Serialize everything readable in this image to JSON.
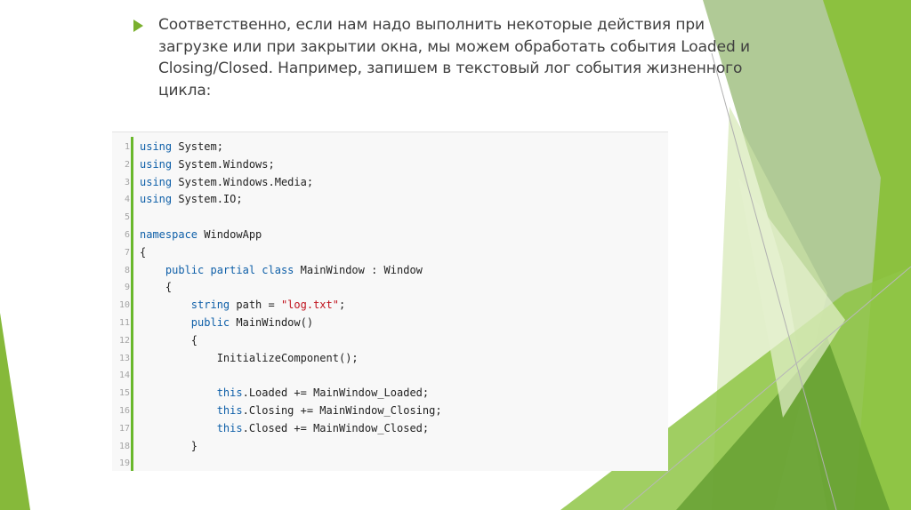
{
  "slide": {
    "paragraph": [
      "Соответственно, если нам надо выполнить некоторые действия при",
      "загрузке или при закрытии окна, мы можем обработать события Loaded и",
      "Closing/Closed. Например, запишем в текстовый лог события жизненного",
      "цикла:"
    ]
  },
  "code": {
    "line_numbers": [
      "1",
      "2",
      "3",
      "4",
      "5",
      "6",
      "7",
      "8",
      "9",
      "10",
      "11",
      "12",
      "13",
      "14",
      "15",
      "16",
      "17",
      "18",
      "19"
    ],
    "lines": [
      [
        {
          "t": "using",
          "k": "kw"
        },
        {
          "t": " System;"
        }
      ],
      [
        {
          "t": "using",
          "k": "kw"
        },
        {
          "t": " System.Windows;"
        }
      ],
      [
        {
          "t": "using",
          "k": "kw"
        },
        {
          "t": " System.Windows.Media;"
        }
      ],
      [
        {
          "t": "using",
          "k": "kw"
        },
        {
          "t": " System.IO;"
        }
      ],
      [
        {
          "t": ""
        }
      ],
      [
        {
          "t": "namespace",
          "k": "kw"
        },
        {
          "t": " WindowApp"
        }
      ],
      [
        {
          "t": "{"
        }
      ],
      [
        {
          "t": "    "
        },
        {
          "t": "public partial class",
          "k": "kw"
        },
        {
          "t": " MainWindow : Window"
        }
      ],
      [
        {
          "t": "    {"
        }
      ],
      [
        {
          "t": "        "
        },
        {
          "t": "string",
          "k": "kw"
        },
        {
          "t": " path = "
        },
        {
          "t": "\"log.txt\"",
          "k": "str"
        },
        {
          "t": ";"
        }
      ],
      [
        {
          "t": "        "
        },
        {
          "t": "public",
          "k": "kw"
        },
        {
          "t": " MainWindow()"
        }
      ],
      [
        {
          "t": "        {"
        }
      ],
      [
        {
          "t": "            InitializeComponent();"
        }
      ],
      [
        {
          "t": ""
        }
      ],
      [
        {
          "t": "            "
        },
        {
          "t": "this",
          "k": "kw"
        },
        {
          "t": ".Loaded += MainWindow_Loaded;"
        }
      ],
      [
        {
          "t": "            "
        },
        {
          "t": "this",
          "k": "kw"
        },
        {
          "t": ".Closing += MainWindow_Closing;"
        }
      ],
      [
        {
          "t": "            "
        },
        {
          "t": "this",
          "k": "kw"
        },
        {
          "t": ".Closed += MainWindow_Closed;"
        }
      ],
      [
        {
          "t": "        }"
        }
      ],
      [
        {
          "t": ""
        }
      ]
    ]
  },
  "colors": {
    "accent_green": "#7ab02e",
    "keyword": "#0e5fa8",
    "string": "#c0131e"
  }
}
